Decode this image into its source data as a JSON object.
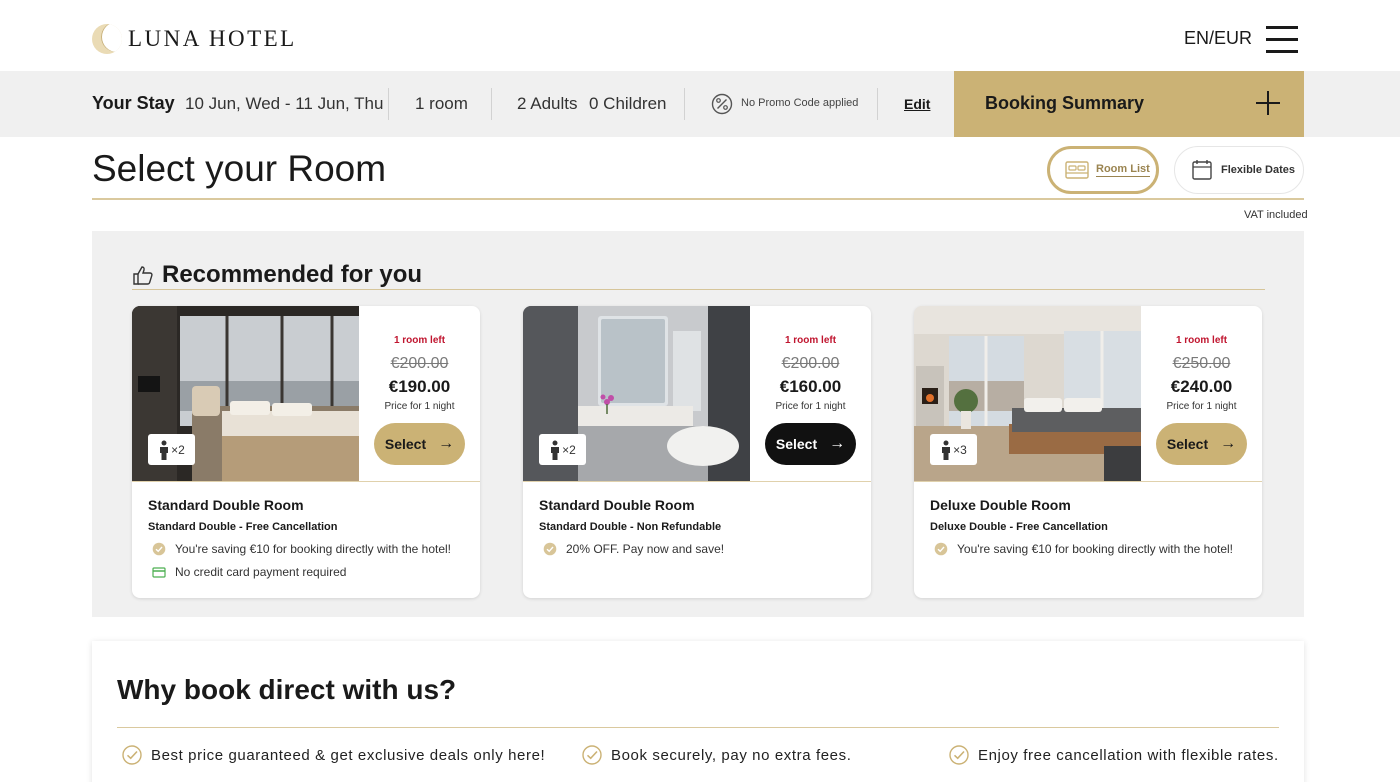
{
  "header": {
    "logo_text": "LUNA HOTEL",
    "lang_currency": "EN/EUR"
  },
  "stay": {
    "label": "Your Stay",
    "dates": "10 Jun, Wed - 11 Jun, Thu",
    "rooms": "1 room",
    "adults": "2 Adults",
    "children": "0 Children",
    "promo": "No Promo Code applied",
    "edit": "Edit",
    "summary": "Booking Summary"
  },
  "page": {
    "title": "Select your Room",
    "room_list": "Room List",
    "flexible_dates": "Flexible Dates",
    "vat": "VAT included"
  },
  "recommended": {
    "title": "Recommended for you",
    "cards": [
      {
        "rooms_left": "1 room left",
        "old_price": "€200.00",
        "price": "€190.00",
        "per_night": "Price for 1 night",
        "select": "Select",
        "guests": "2",
        "room": "Standard Double Room",
        "rate": "Standard Double - Free Cancellation",
        "features": [
          "You're saving €10 for booking directly with the hotel!",
          "No credit card payment required"
        ],
        "button_style": "gold"
      },
      {
        "rooms_left": "1 room left",
        "old_price": "€200.00",
        "price": "€160.00",
        "per_night": "Price for 1 night",
        "select": "Select",
        "guests": "2",
        "room": "Standard Double Room",
        "rate": "Standard Double - Non Refundable",
        "features": [
          "20% OFF. Pay now and save!"
        ],
        "button_style": "dark"
      },
      {
        "rooms_left": "1 room left",
        "old_price": "€250.00",
        "price": "€240.00",
        "per_night": "Price for 1 night",
        "select": "Select",
        "guests": "3",
        "room": "Deluxe Double Room",
        "rate": "Deluxe Double - Free Cancellation",
        "features": [
          "You're saving €10 for booking directly with the hotel!"
        ],
        "button_style": "gold"
      }
    ]
  },
  "why": {
    "title": "Why book direct with us?",
    "items": [
      "Best price guaranteed & get exclusive deals only here!",
      "Book securely, pay no extra fees.",
      "Enjoy free cancellation with flexible rates."
    ]
  },
  "colors": {
    "accent_gold": "#cbb275",
    "alert_red": "#c0152f",
    "bar_grey": "#f0f0f0",
    "dark_button": "#111111"
  }
}
